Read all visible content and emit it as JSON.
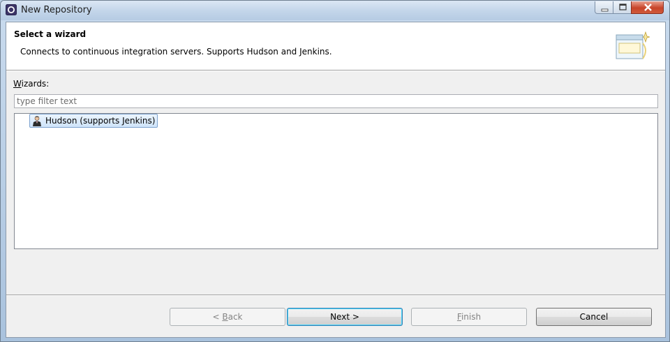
{
  "window": {
    "title": "New Repository",
    "icon": "eclipse-app-icon"
  },
  "banner": {
    "title": "Select a wizard",
    "description": "Connects to continuous integration servers. Supports Hudson and Jenkins.",
    "icon": "wizard-banner-icon"
  },
  "wizards": {
    "label_mnemonic": "W",
    "label_rest": "izards:",
    "filter_placeholder": "type filter text",
    "items": [
      {
        "label": "Hudson (supports Jenkins)",
        "icon": "hudson-butler-icon",
        "selected": true
      }
    ]
  },
  "buttons": {
    "back": {
      "pre": "< ",
      "mnemonic": "B",
      "post": "ack",
      "enabled": false
    },
    "next": {
      "label": "Next >",
      "enabled": true
    },
    "finish": {
      "mnemonic": "F",
      "post": "inish",
      "enabled": false
    },
    "cancel": {
      "label": "Cancel",
      "enabled": true
    }
  }
}
